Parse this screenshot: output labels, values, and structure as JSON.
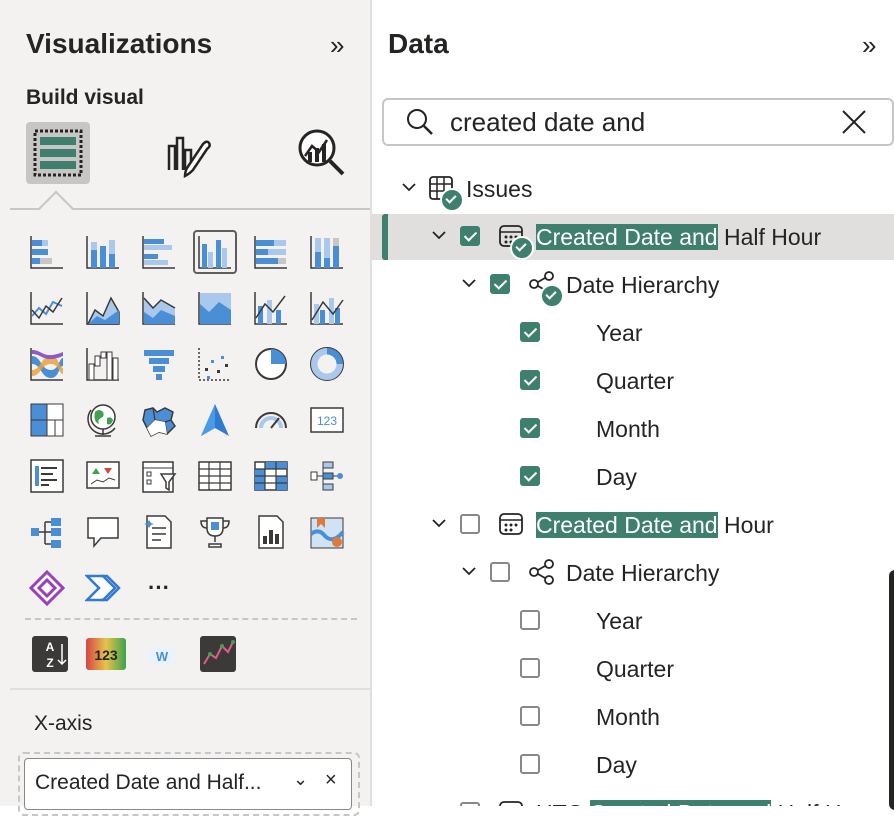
{
  "visualizations": {
    "title": "Visualizations",
    "collapse_glyph": "»",
    "build_visual_label": "Build visual",
    "tabs": [
      {
        "icon": "build-visual-icon",
        "active": true
      },
      {
        "icon": "format-visual-icon",
        "active": false
      },
      {
        "icon": "analytics-icon",
        "active": false
      }
    ],
    "visual_icons": [
      "stacked-bar-chart-icon",
      "stacked-column-chart-icon",
      "clustered-bar-chart-icon",
      "clustered-column-chart-icon",
      "100-stacked-bar-chart-icon",
      "100-stacked-column-chart-icon",
      "line-chart-icon",
      "area-chart-icon",
      "stacked-area-chart-icon",
      "100-stacked-area-chart-icon",
      "line-and-stacked-column-chart-icon",
      "line-and-clustered-column-chart-icon",
      "ribbon-chart-icon",
      "waterfall-chart-icon",
      "funnel-icon",
      "scatter-chart-icon",
      "pie-chart-icon",
      "donut-chart-icon",
      "treemap-icon",
      "map-icon",
      "filled-map-icon",
      "azure-map-icon",
      "gauge-icon",
      "card-icon",
      "multi-row-card-icon",
      "kpi-icon",
      "slicer-icon",
      "table-icon",
      "matrix-icon",
      "decomposition-tree-icon",
      "key-influencers-icon",
      "qa-icon",
      "smart-narrative-icon",
      "metrics-icon",
      "paginated-report-icon",
      "arcgis-map-icon",
      "power-apps-icon",
      "power-automate-icon",
      "more-visuals-icon"
    ],
    "more_glyph": "···",
    "custom_icons": [
      "az-sort-visual-icon",
      "card-123-visual-icon",
      "word-cloud-visual-icon",
      "sparkline-visual-icon"
    ],
    "card_text": "123",
    "az_text": "A Z",
    "wordcloud_text": "W",
    "xaxis_label": "X-axis",
    "xaxis_field": "Created Date and Half...",
    "xaxis_chevron": "⌄",
    "xaxis_remove": "×"
  },
  "data": {
    "title": "Data",
    "collapse_glyph": "»",
    "search_value": "created date and",
    "tree": [
      {
        "level": 0,
        "expanded": true,
        "icon": "table-icon",
        "badge": true,
        "label": "Issues",
        "highlight": "",
        "rest": "Issues",
        "checkbox": null,
        "selected": false
      },
      {
        "level": 1,
        "expanded": true,
        "icon": "calendar-icon",
        "badge": true,
        "label": "Created Date and Half Hour",
        "highlight": "Created Date and",
        "rest": " Half Hour",
        "checkbox": true,
        "selected": true
      },
      {
        "level": 2,
        "expanded": true,
        "icon": "hierarchy-icon",
        "badge": true,
        "label": "Date Hierarchy",
        "highlight": "",
        "rest": "Date Hierarchy",
        "checkbox": true,
        "selected": false
      },
      {
        "level": 3,
        "label": "Year",
        "highlight": "",
        "rest": "Year",
        "checkbox": true
      },
      {
        "level": 3,
        "label": "Quarter",
        "highlight": "",
        "rest": "Quarter",
        "checkbox": true
      },
      {
        "level": 3,
        "label": "Month",
        "highlight": "",
        "rest": "Month",
        "checkbox": true
      },
      {
        "level": 3,
        "label": "Day",
        "highlight": "",
        "rest": "Day",
        "checkbox": true
      },
      {
        "level": 1,
        "expanded": true,
        "icon": "calendar-icon",
        "badge": false,
        "label": "Created Date and Hour",
        "highlight": "Created Date and",
        "rest": " Hour",
        "checkbox": false,
        "selected": false
      },
      {
        "level": 2,
        "expanded": true,
        "icon": "hierarchy-icon",
        "badge": false,
        "label": "Date Hierarchy",
        "highlight": "",
        "rest": "Date Hierarchy",
        "checkbox": false,
        "selected": false
      },
      {
        "level": 3,
        "label": "Year",
        "highlight": "",
        "rest": "Year",
        "checkbox": false
      },
      {
        "level": 3,
        "label": "Quarter",
        "highlight": "",
        "rest": "Quarter",
        "checkbox": false
      },
      {
        "level": 3,
        "label": "Month",
        "highlight": "",
        "rest": "Month",
        "checkbox": false
      },
      {
        "level": 3,
        "label": "Day",
        "highlight": "",
        "rest": "Day",
        "checkbox": false
      },
      {
        "level": 1,
        "expanded": true,
        "icon": "calendar-icon",
        "badge": false,
        "label": "UTC Created Date and Half H",
        "highlight": "Created Date and",
        "prefix": "UTC ",
        "rest": " Half H",
        "checkbox": false,
        "selected": false
      }
    ]
  },
  "colors": {
    "accent": "#3e7f6e",
    "visual_blue": "#4a8fd6",
    "panel_bg": "#f3f2f1",
    "text": "#252423"
  }
}
